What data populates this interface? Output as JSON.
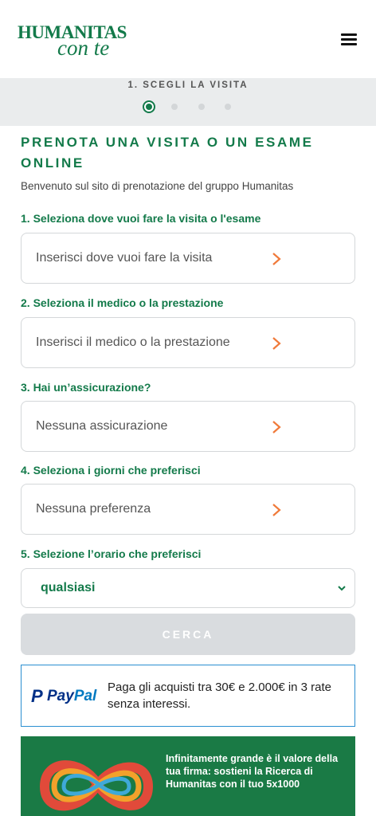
{
  "header": {
    "logo_top": "HUMANITAS",
    "logo_bottom": "con te",
    "menu_icon": "hamburger-menu-icon"
  },
  "stepper": {
    "label": "1. SCEGLI LA VISITA",
    "current_step": 1,
    "total_steps": 4
  },
  "form": {
    "title": "PRENOTA UNA VISITA O UN ESAME ONLINE",
    "subtitle": "Benvenuto sul sito di prenotazione del gruppo Humanitas",
    "fields": [
      {
        "label": "1. Seleziona dove vuoi fare la visita o l'esame",
        "placeholder": "Inserisci dove vuoi fare la visita"
      },
      {
        "label": "2. Seleziona il medico o la prestazione",
        "placeholder": "Inserisci il medico o la prestazione"
      },
      {
        "label": "3. Hai un’assicurazione?",
        "placeholder": "Nessuna assicurazione"
      },
      {
        "label": "4. Seleziona i giorni che preferisci",
        "placeholder": "Nessuna preferenza"
      }
    ],
    "time": {
      "label": "5. Selezione l’orario che preferisci",
      "value": "qualsiasi"
    },
    "search_button": "CERCA"
  },
  "paypal": {
    "logo_p": "P",
    "logo_pay": "Pay",
    "logo_pal": "Pal",
    "text": "Paga gli acquisti tra 30€ e 2.000€ in 3 rate senza interessi."
  },
  "banner": {
    "text": "Infinitamente grande è il valore della tua firma: sostieni la Ricerca di Humanitas con il tuo 5x1000"
  },
  "colors": {
    "brand_green": "#137a4a",
    "chevron_orange": "#f07a3a",
    "disabled_button": "#d9dcdf",
    "paypal_border": "#2a8fd1"
  }
}
